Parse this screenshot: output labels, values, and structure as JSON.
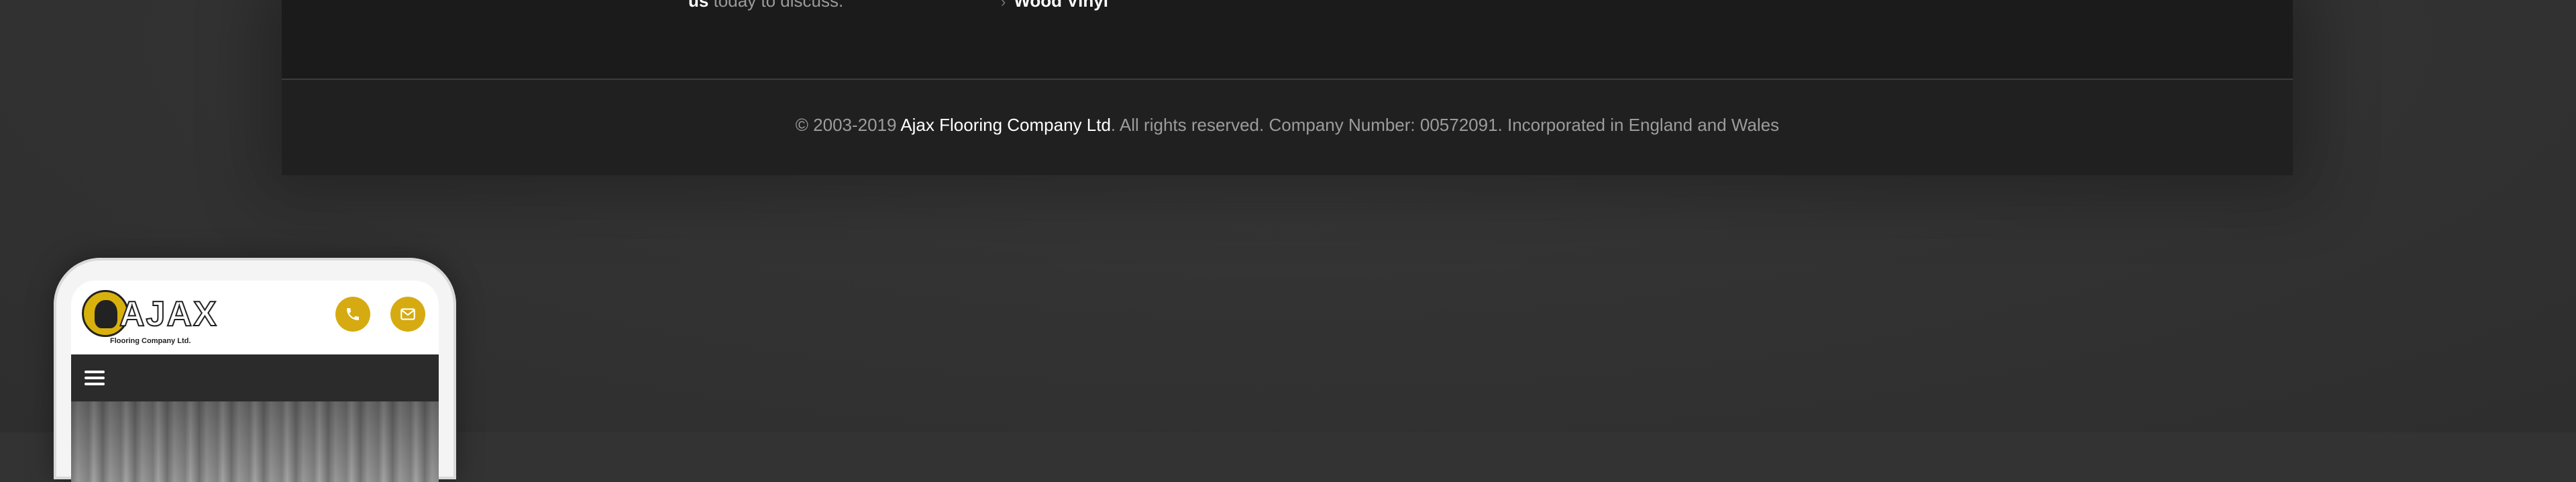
{
  "footer": {
    "partial_left_strong": "us",
    "partial_left_text": " today to discuss.",
    "partial_right_chevron": "›",
    "partial_right_text": "Wood Vinyl",
    "copyright_prefix": "© 2003-2019 ",
    "company_name": "Ajax Flooring Company Ltd",
    "copyright_suffix": ". All rights reserved. Company Number: 00572091. Incorporated in England and Wales"
  },
  "mobile_preview": {
    "logo_text": "AJAX",
    "logo_subtext": "Flooring Company Ltd.",
    "phone_icon": "phone-icon",
    "mail_icon": "envelope-icon",
    "menu_icon": "hamburger-menu-icon"
  },
  "colors": {
    "page_background": "#333333",
    "footer_background": "#1b1b1b",
    "accent_gold": "#d6ab12",
    "text_muted": "#9c9c9c",
    "text_white": "#ffffff"
  }
}
